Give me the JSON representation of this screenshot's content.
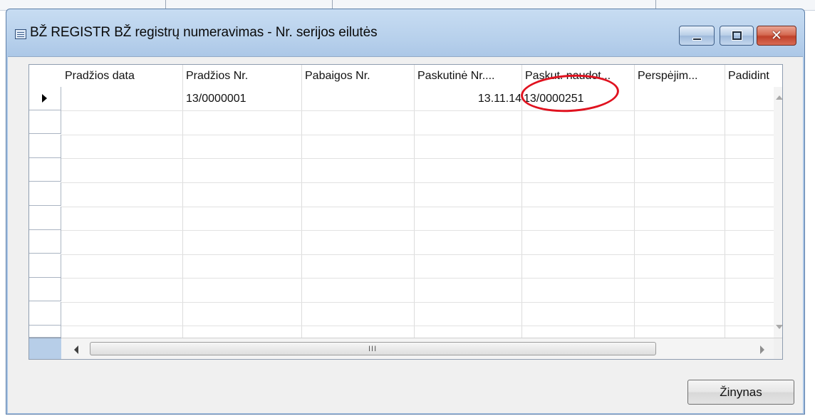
{
  "window": {
    "title": "BŽ REGISTR BŽ registrų numeravimas - Nr. serijos eilutės",
    "controls": {
      "close_glyph": "✕"
    }
  },
  "grid": {
    "columns": [
      {
        "label": "Pradžios data"
      },
      {
        "label": "Pradžios Nr."
      },
      {
        "label": "Pabaigos Nr."
      },
      {
        "label": "Paskutinė Nr...."
      },
      {
        "label": "Paskut. naudot..."
      },
      {
        "label": "Perspėjim..."
      },
      {
        "label": "Padidint"
      }
    ],
    "rows": [
      {
        "start_date": "",
        "start_no": "13/0000001",
        "end_no": "",
        "last_date": "13.11.14",
        "last_used_no": "13/0000251",
        "warning_no": "",
        "increment": ""
      }
    ],
    "empty_row_count": 10,
    "hscroll_grip": "III"
  },
  "buttons": {
    "help_label": "Žinynas"
  },
  "colors": {
    "highlight_circle": "#e0121f",
    "title_bar": "#b8d1ec",
    "close_button": "#c0412a"
  }
}
